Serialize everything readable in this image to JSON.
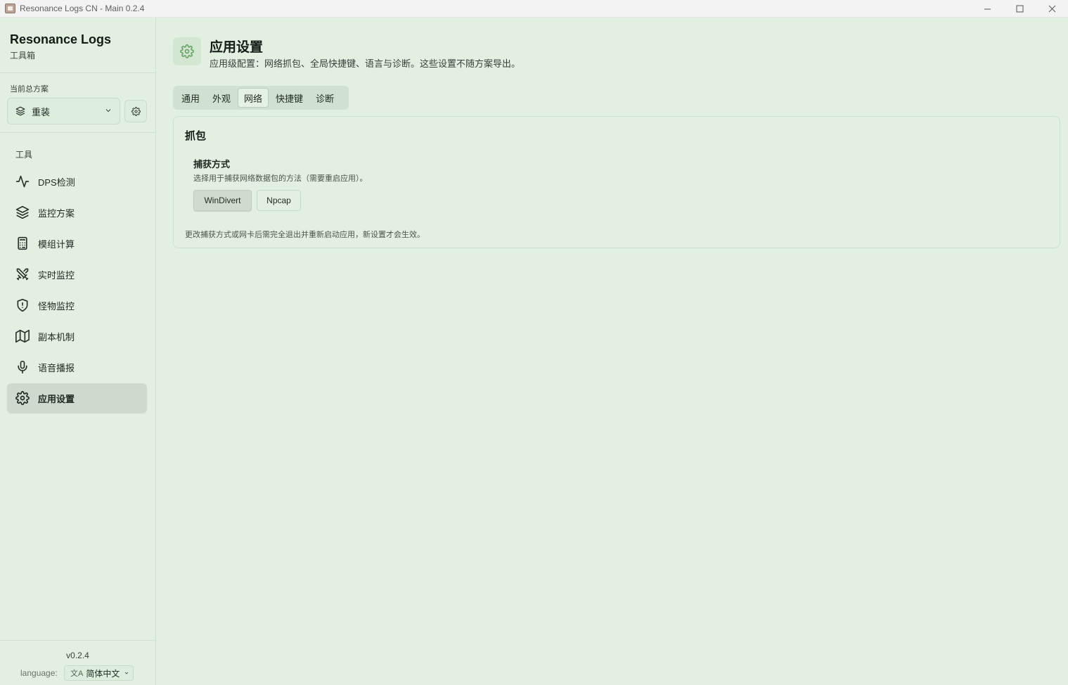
{
  "window": {
    "title": "Resonance Logs CN - Main 0.2.4",
    "minimize_glyph": "—",
    "maximize_glyph": "☐",
    "close_glyph": "✕"
  },
  "sidebar": {
    "brand_title": "Resonance Logs",
    "brand_subtitle": "工具箱",
    "profile_label": "当前总方案",
    "profile_value": "重装",
    "tools_label": "工具",
    "items": [
      {
        "label": "DPS检测",
        "icon": "activity-icon"
      },
      {
        "label": "监控方案",
        "icon": "layers-icon"
      },
      {
        "label": "模组计算",
        "icon": "calculator-icon"
      },
      {
        "label": "实时监控",
        "icon": "swords-icon"
      },
      {
        "label": "怪物监控",
        "icon": "shield-icon"
      },
      {
        "label": "副本机制",
        "icon": "map-icon"
      },
      {
        "label": "语音播报",
        "icon": "mic-icon"
      },
      {
        "label": "应用设置",
        "icon": "gear-icon",
        "active": true
      }
    ],
    "version": "v0.2.4",
    "language_label": "language:",
    "language_value": "简体中文",
    "language_icon_glyph": "文A"
  },
  "main": {
    "title": "应用设置",
    "description": "应用级配置：网络抓包、全局快捷键、语言与诊断。这些设置不随方案导出。",
    "tabs": [
      {
        "label": "通用"
      },
      {
        "label": "外观"
      },
      {
        "label": "网络",
        "active": true
      },
      {
        "label": "快捷键"
      },
      {
        "label": "诊断"
      }
    ],
    "card": {
      "title": "抓包",
      "field_label": "捕获方式",
      "field_desc": "选择用于捕获网络数据包的方法（需要重启应用）。",
      "options": [
        {
          "label": "WinDivert",
          "selected": true
        },
        {
          "label": "Npcap",
          "selected": false
        }
      ],
      "note": "更改捕获方式或网卡后需完全退出并重新启动应用，新设置才会生效。"
    }
  },
  "colors": {
    "background": "#e1f0e1",
    "active_nav": "#cddacd",
    "accent_icon": "#6aa56a"
  }
}
